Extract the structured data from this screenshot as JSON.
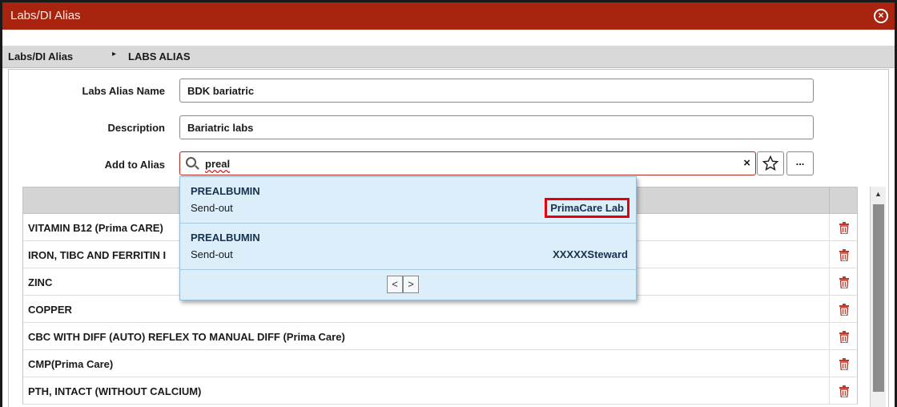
{
  "window": {
    "title": "Labs/DI Alias",
    "close_glyph": "×"
  },
  "breadcrumb": {
    "parent": "Labs/DI Alias",
    "separator": "▸",
    "current": "LABS ALIAS"
  },
  "form": {
    "alias_name_label": "Labs Alias Name",
    "alias_name_value": "BDK bariatric",
    "description_label": "Description",
    "description_value": "Bariatric labs",
    "add_to_alias_label": "Add to Alias",
    "search_value": "preal",
    "clear_glyph": "×",
    "more_glyph": "..."
  },
  "dropdown": {
    "results": [
      {
        "name": "PREALBUMIN",
        "type": "Send-out",
        "lab": "PrimaCare Lab"
      },
      {
        "name": "PREALBUMIN",
        "type": "Send-out",
        "lab": "XXXXXSteward"
      }
    ],
    "prev_glyph": "<",
    "next_glyph": ">"
  },
  "table": {
    "rows": [
      "VITAMIN B12 (Prima CARE)",
      "IRON, TIBC AND FERRITIN I",
      "ZINC",
      "COPPER",
      "CBC WITH DIFF (AUTO) REFLEX TO MANUAL DIFF (Prima Care)",
      "CMP(Prima Care)",
      "PTH, INTACT (WITHOUT CALCIUM)"
    ]
  },
  "colors": {
    "titlebar": "#a8240f",
    "dropdown_bg": "#dbeefa",
    "trash": "#c0392b",
    "highlight_box": "#e3000f"
  },
  "icons": [
    "close-icon",
    "search-icon",
    "star-icon",
    "trash-icon",
    "scroll-up-icon"
  ]
}
